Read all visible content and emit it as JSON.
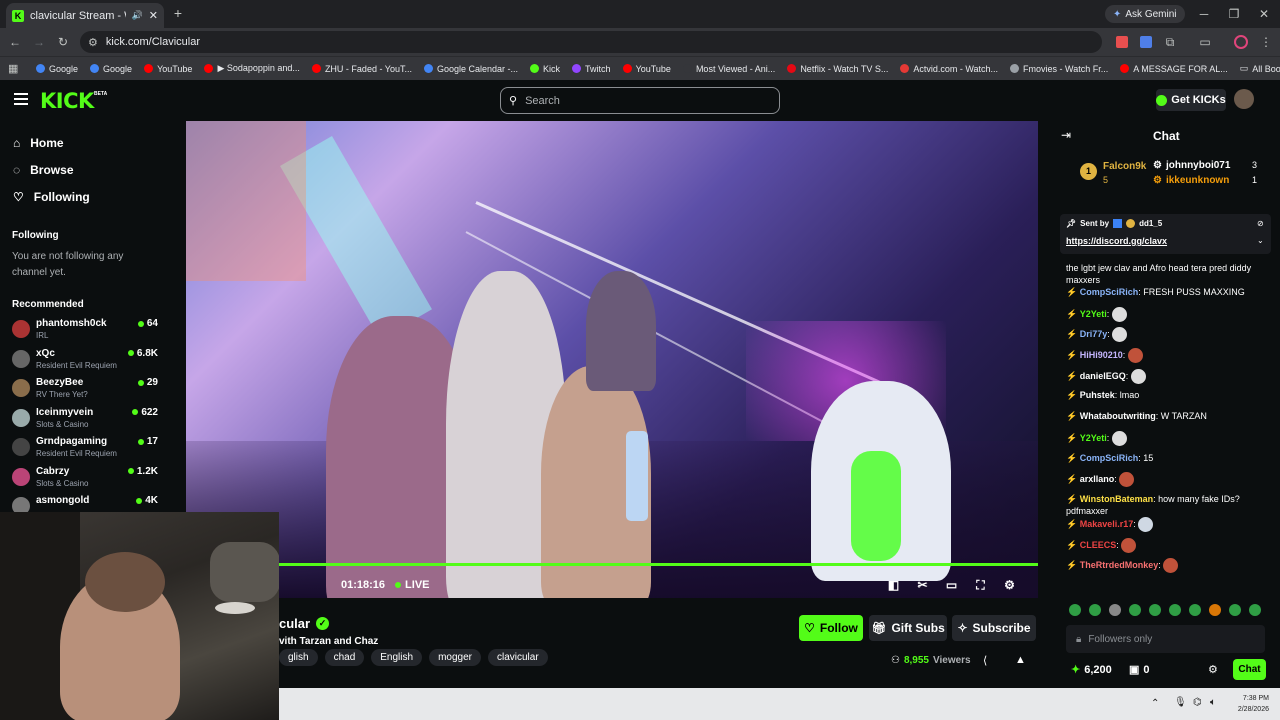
{
  "browser": {
    "tab_title": "clavicular Stream - Watch L",
    "tab_audio": "🔊",
    "url": "kick.com/Clavicular",
    "ask_gemini": "Ask Gemini",
    "bookmarks": [
      {
        "label": "Google",
        "color": "#4285f4"
      },
      {
        "label": "Google",
        "color": "#4285f4"
      },
      {
        "label": "YouTube",
        "color": "#ff0000"
      },
      {
        "label": "▶ Sodapoppin and...",
        "color": "#ff0000"
      },
      {
        "label": "ZHU - Faded - YouT...",
        "color": "#ff0000"
      },
      {
        "label": "Google Calendar -...",
        "color": "#4285f4"
      },
      {
        "label": "Kick",
        "color": "#53fc18"
      },
      {
        "label": "Twitch",
        "color": "#9146ff"
      },
      {
        "label": "YouTube",
        "color": "#ff0000"
      },
      {
        "label": "Most Viewed - Ani...",
        "color": "#35363a"
      },
      {
        "label": "Netflix - Watch TV S...",
        "color": "#e50914"
      },
      {
        "label": "Actvid.com - Watch...",
        "color": "#e53935"
      },
      {
        "label": "Fmovies - Watch Fr...",
        "color": "#9aa0a6"
      },
      {
        "label": "A MESSAGE FOR AL...",
        "color": "#ff0000"
      }
    ],
    "all_bookmarks": "All Bookmarks"
  },
  "header": {
    "logo": "KICK",
    "logo_beta": "BETA",
    "search_placeholder": "Search",
    "get_kicks": "Get KICKs"
  },
  "sidebar": {
    "nav": [
      {
        "label": "Home",
        "icon": "⌂"
      },
      {
        "label": "Browse",
        "icon": "◌"
      },
      {
        "label": "Following",
        "icon": "♡"
      }
    ],
    "following_title": "Following",
    "following_empty": "You are not following any channel yet.",
    "recommended_title": "Recommended",
    "recommended": [
      {
        "name": "phantomsh0ck",
        "category": "IRL",
        "viewers": "64",
        "color": "#a33"
      },
      {
        "name": "xQc",
        "category": "Resident Evil Requiem",
        "viewers": "6.8K",
        "color": "#666"
      },
      {
        "name": "BeezyBee",
        "category": "RV There Yet?",
        "viewers": "29",
        "color": "#8a6d4b"
      },
      {
        "name": "Iceinmyvein",
        "category": "Slots & Casino",
        "viewers": "622",
        "color": "#9aa"
      },
      {
        "name": "Grndpagaming",
        "category": "Resident Evil Requiem",
        "viewers": "17",
        "color": "#444"
      },
      {
        "name": "Cabrzy",
        "category": "Slots & Casino",
        "viewers": "1.2K",
        "color": "#b47"
      },
      {
        "name": "asmongold",
        "category": "",
        "viewers": "4K",
        "color": "#777"
      }
    ]
  },
  "player": {
    "time": "01:18:16",
    "live": "LIVE",
    "progress": 1.0
  },
  "stream": {
    "channel_partial": "cular",
    "title_partial": "vith Tarzan and Chaz",
    "tags": [
      "glish",
      "chad",
      "English",
      "mogger",
      "clavicular"
    ],
    "follow": "Follow",
    "gift_subs": "Gift Subs",
    "subscribe": "Subscribe",
    "viewers_count": "8,955",
    "viewers_label": "Viewers"
  },
  "chat": {
    "title": "Chat",
    "leaderboard": [
      {
        "rank": "1",
        "name": "Falcon9k",
        "count": "5",
        "color": "#e0b341"
      },
      {
        "name": "johnnyboi071",
        "count": "3",
        "color": "#fff"
      },
      {
        "name": "ikkeunknown",
        "count": "1",
        "color": "#f59e0b"
      }
    ],
    "pinned_sent_by": "Sent by",
    "pinned_user": "dd1_5",
    "pinned_link": "https://discord.gg/clavx",
    "messages": [
      {
        "user": "",
        "text": "the lgbt jew clav and Afro head tera pred diddy maxxers",
        "color": "#fff",
        "emote": ""
      },
      {
        "user": "CompSciRich",
        "text": "FRESH PUSS MAXXING",
        "color": "#8ab4f8",
        "emote": ""
      },
      {
        "user": "Y2Yeti",
        "text": "",
        "color": "#53fc18",
        "emote": "#ddd"
      },
      {
        "user": "Dri77y",
        "text": "",
        "color": "#8ab4f8",
        "emote": "#ddd"
      },
      {
        "user": "HiHi90210",
        "text": "",
        "color": "#c4b5fd",
        "emote": "#c0523a"
      },
      {
        "user": "danielEGQ",
        "text": "",
        "color": "#fff",
        "emote": "#ddd"
      },
      {
        "user": "Puhstek",
        "text": "lmao",
        "color": "#fff",
        "emote": ""
      },
      {
        "user": "Whataboutwriting",
        "text": "W TARZAN",
        "color": "#fff",
        "emote": ""
      },
      {
        "user": "Y2Yeti",
        "text": "",
        "color": "#53fc18",
        "emote": "#ddd"
      },
      {
        "user": "CompSciRich",
        "text": "15",
        "color": "#8ab4f8",
        "emote": ""
      },
      {
        "user": "arxllano",
        "text": "",
        "color": "#fff",
        "emote": "#c0523a"
      },
      {
        "user": "WinstonBateman",
        "text": "how many fake IDs? pdfmaxxer",
        "color": "#fde047",
        "emote": ""
      },
      {
        "user": "Makaveli.r17",
        "text": "",
        "color": "#ef4444",
        "emote": "#cfd8e3"
      },
      {
        "user": "CLEECS",
        "text": "",
        "color": "#ef4444",
        "emote": "#c0523a"
      },
      {
        "user": "TheRtrdedMonkey",
        "text": "",
        "color": "#f87171",
        "emote": "#c0523a"
      }
    ],
    "input_placeholder": "Followers only",
    "points": "6,200",
    "gift_count": "0",
    "chat_button": "Chat"
  },
  "taskbar": {
    "time": "7:38 PM",
    "date": "2/28/2026"
  }
}
